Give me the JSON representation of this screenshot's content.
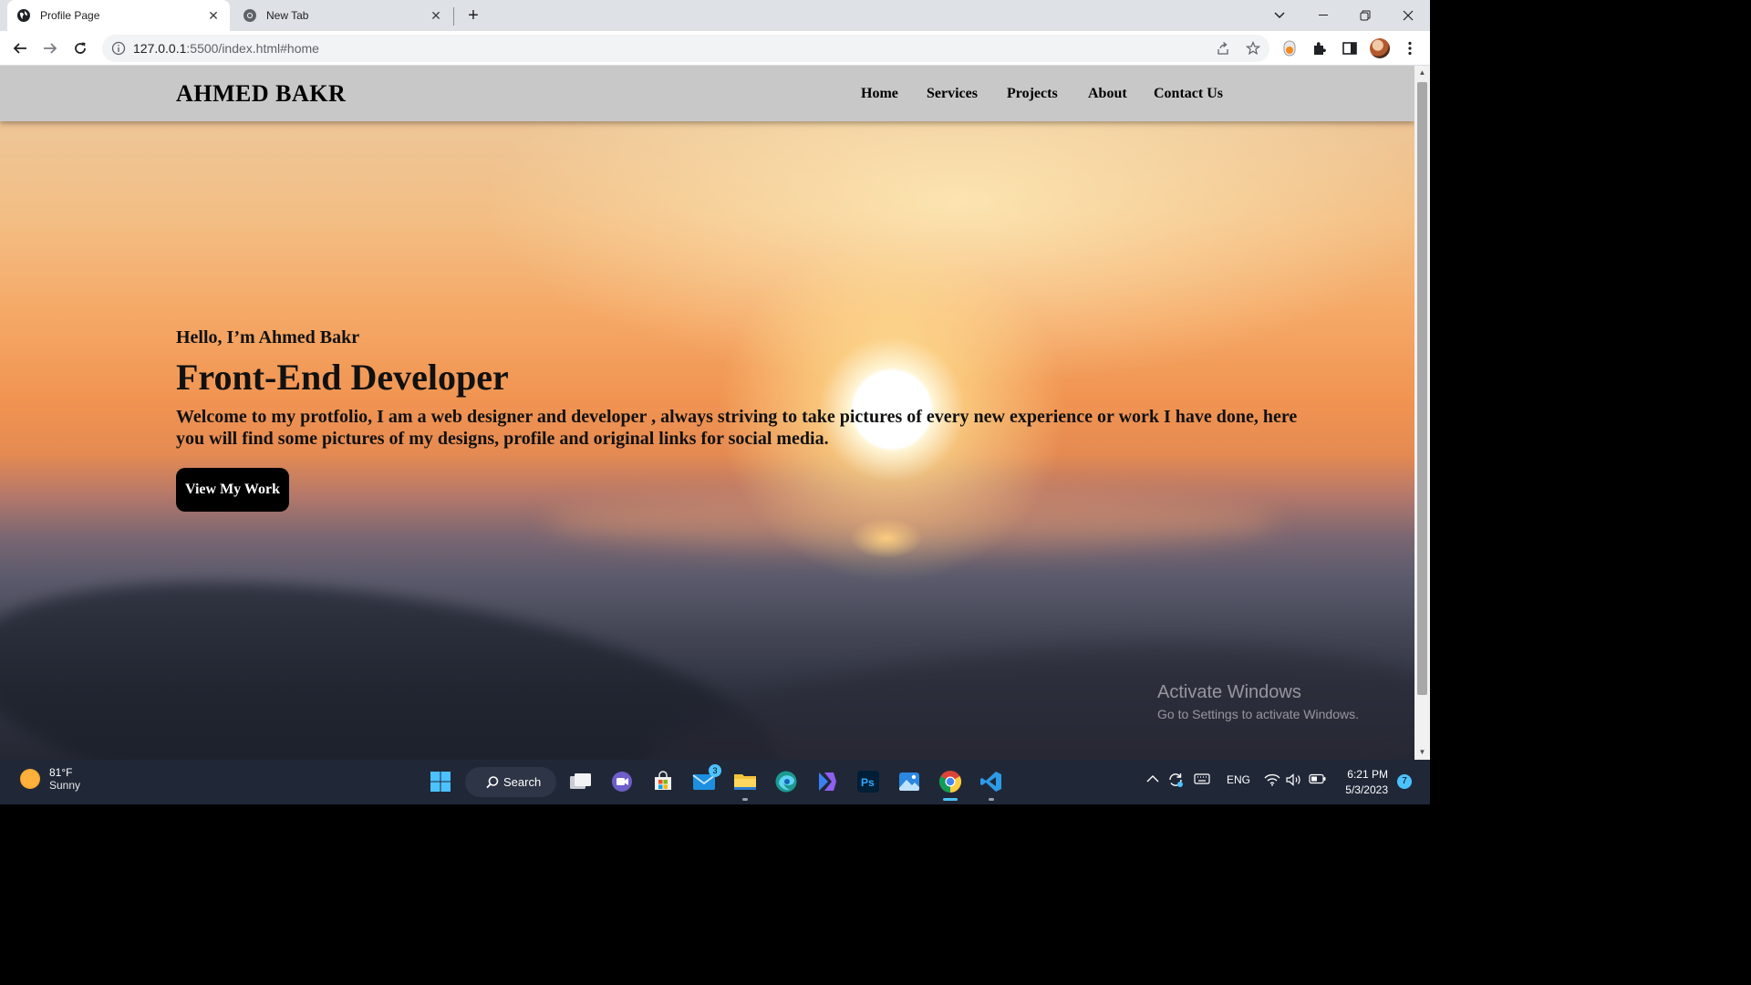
{
  "browser": {
    "tabs": [
      {
        "title": "Profile Page",
        "active": true
      },
      {
        "title": "New Tab",
        "active": false
      }
    ],
    "url_host": "127.0.0.1",
    "url_rest": ":5500/index.html#home"
  },
  "site": {
    "logo": "AHMED BAKR",
    "nav": [
      {
        "label": "Home"
      },
      {
        "label": "Services"
      },
      {
        "label": "Projects"
      },
      {
        "label": "About"
      },
      {
        "label": "Contact Us"
      }
    ],
    "hero": {
      "greeting": "Hello, I’m Ahmed Bakr",
      "role": "Front-End Developer",
      "intro": "Welcome to my protfolio, I am a web designer and developer , always striving to take pictures of every new experience or work I have done, here you will find some pictures of my designs, profile and original links for social media.",
      "cta": "View My Work"
    }
  },
  "watermark": {
    "line1": "Activate Windows",
    "line2": "Go to Settings to activate Windows."
  },
  "taskbar": {
    "weather_temp": "81°F",
    "weather_desc": "Sunny",
    "search_label": "Search",
    "mail_badge": "3",
    "language": "ENG",
    "time": "6:21 PM",
    "date": "5/3/2023",
    "notification_count": "7"
  }
}
